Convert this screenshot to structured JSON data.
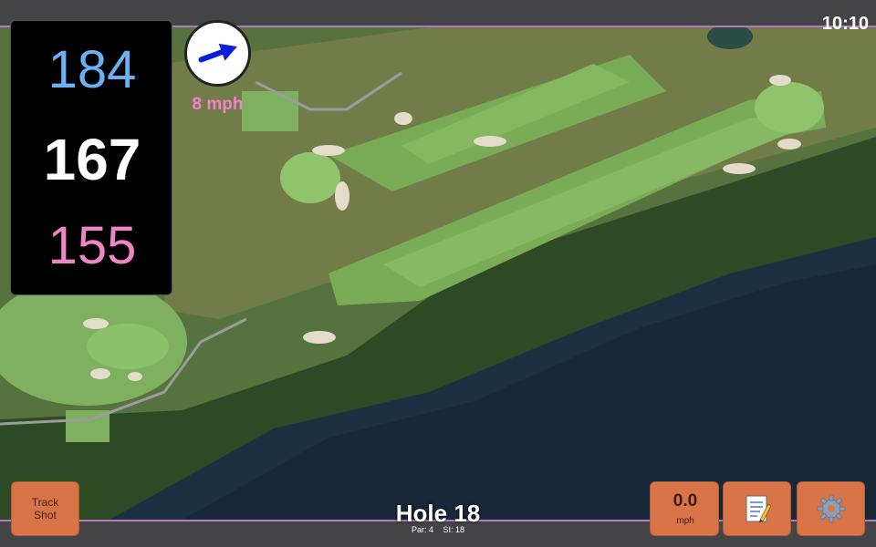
{
  "status_bar": {
    "time": "10:10"
  },
  "distances": {
    "back": "184",
    "middle": "167",
    "front": "155",
    "colors": {
      "back": "#6ab0f2",
      "middle": "#ffffff",
      "front": "#f184c8"
    }
  },
  "wind": {
    "speed": "8 mph",
    "direction_icon": "arrow-right-icon",
    "arrow_color": "#0a1fdc",
    "speed_color": "#f184c8"
  },
  "hole": {
    "title": "Hole 18",
    "par": "Par: 4",
    "stroke_index": "SI: 18"
  },
  "buttons": {
    "track_shot": {
      "line1": "Track",
      "line2": "Shot"
    },
    "speed": {
      "value": "0.0",
      "unit": "mph"
    },
    "notes": {
      "icon": "memo-icon"
    },
    "settings": {
      "icon": "gear-icon"
    }
  },
  "map": {
    "background": "aerial golf course satellite map"
  },
  "colors": {
    "button": "#d97448",
    "accent": "#b07bc0"
  }
}
